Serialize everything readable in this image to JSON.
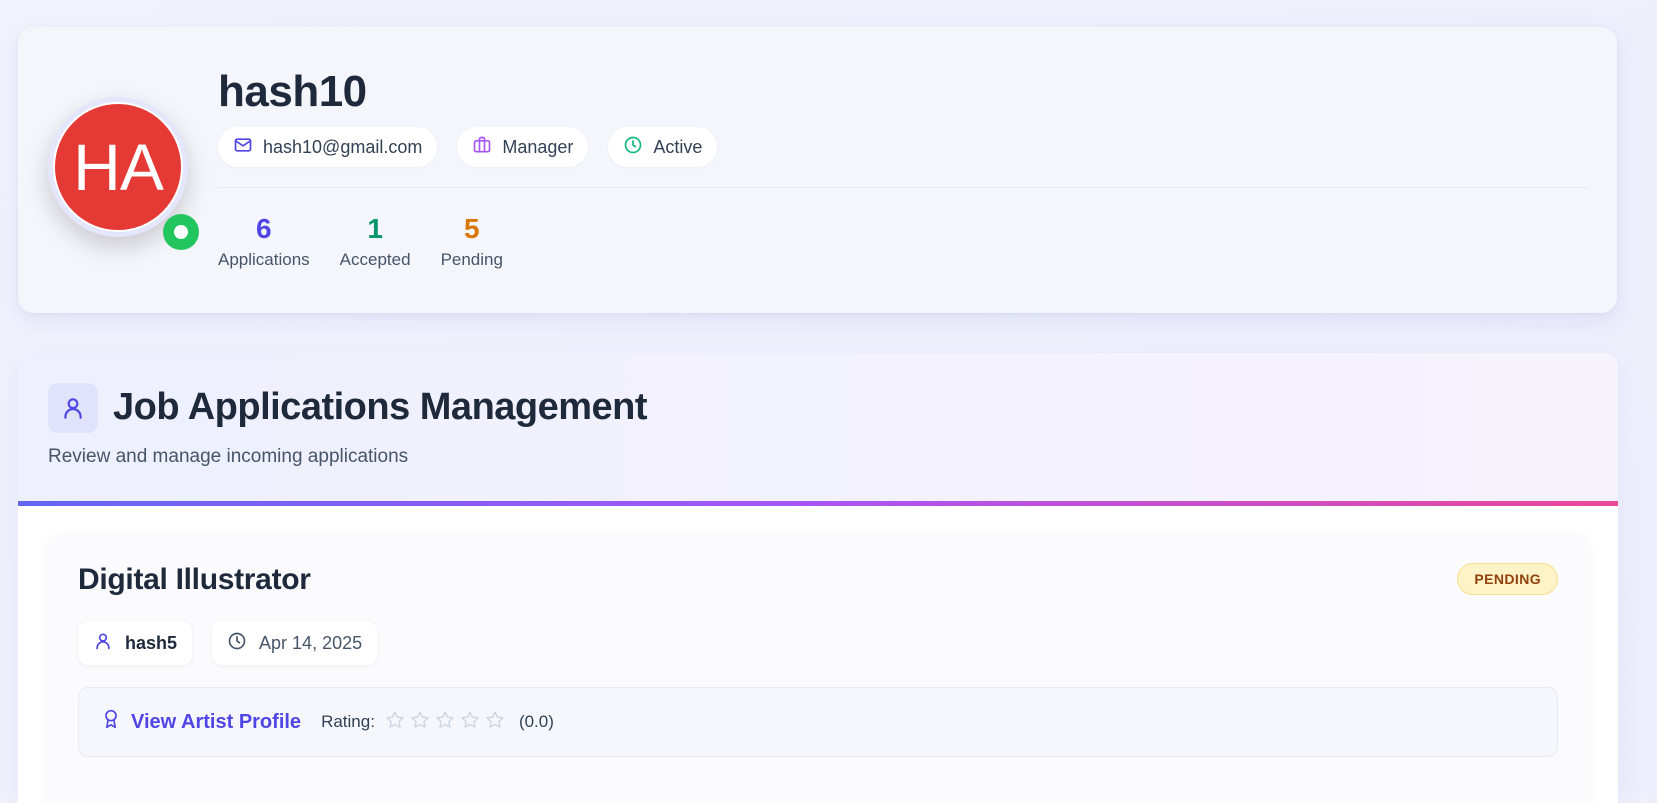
{
  "profile": {
    "initials": "HA",
    "username": "hash10",
    "email": "hash10@gmail.com",
    "role": "Manager",
    "status": "Active",
    "stats": [
      {
        "value": "6",
        "label": "Applications",
        "color": "#4f46e5"
      },
      {
        "value": "1",
        "label": "Accepted",
        "color": "#059669"
      },
      {
        "value": "5",
        "label": "Pending",
        "color": "#d97706"
      }
    ]
  },
  "management": {
    "title": "Job Applications Management",
    "subtitle": "Review and manage incoming applications"
  },
  "application": {
    "job_title": "Digital Illustrator",
    "status_badge": "PENDING",
    "applicant": "hash5",
    "date": "Apr 14, 2025",
    "view_profile_label": "View Artist Profile",
    "rating_label": "Rating:",
    "rating_value": "(0.0)",
    "rating_stars": 0,
    "rating_max": 5
  },
  "colors": {
    "avatar_bg": "#e53935",
    "online_dot": "#22c55e",
    "accent": "#4f46e5"
  }
}
